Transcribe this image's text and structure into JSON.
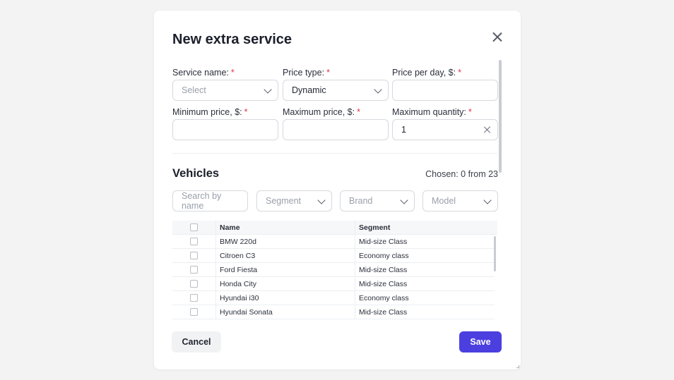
{
  "modal": {
    "title": "New extra service",
    "fields": {
      "service_name": {
        "label": "Service name:",
        "required_mark": "*",
        "placeholder": "Select",
        "value": ""
      },
      "price_type": {
        "label": "Price type:",
        "required_mark": "*",
        "value": "Dynamic"
      },
      "price_per_day": {
        "label": "Price per day, $:",
        "required_mark": "*",
        "value": ""
      },
      "minimum_price": {
        "label": "Minimum price, $:",
        "required_mark": "*",
        "value": ""
      },
      "maximum_price": {
        "label": "Maximum price, $:",
        "required_mark": "*",
        "value": ""
      },
      "maximum_quantity": {
        "label": "Maximum quantity:",
        "required_mark": "*",
        "value": "1"
      }
    },
    "vehicles": {
      "title": "Vehicles",
      "chosen_text": "Chosen: 0 from 23",
      "filters": {
        "search_placeholder": "Search by name",
        "segment_placeholder": "Segment",
        "brand_placeholder": "Brand",
        "model_placeholder": "Model"
      },
      "table": {
        "headers": {
          "name": "Name",
          "segment": "Segment"
        },
        "rows": [
          {
            "name": "BMW 220d",
            "segment": "Mid-size Class"
          },
          {
            "name": "Citroen C3",
            "segment": "Economy class"
          },
          {
            "name": "Ford Fiesta",
            "segment": "Mid-size Class"
          },
          {
            "name": "Honda City",
            "segment": "Mid-size Class"
          },
          {
            "name": "Hyundai i30",
            "segment": "Economy class"
          },
          {
            "name": "Hyundai Sonata",
            "segment": "Mid-size Class"
          }
        ]
      }
    },
    "actions": {
      "cancel_label": "Cancel",
      "save_label": "Save"
    },
    "colors": {
      "accent": "#4b3fe0",
      "required": "#e0374c"
    },
    "icons": {
      "close": "close-icon",
      "dropdown": "chevron-down-icon",
      "clear": "clear-icon"
    }
  }
}
